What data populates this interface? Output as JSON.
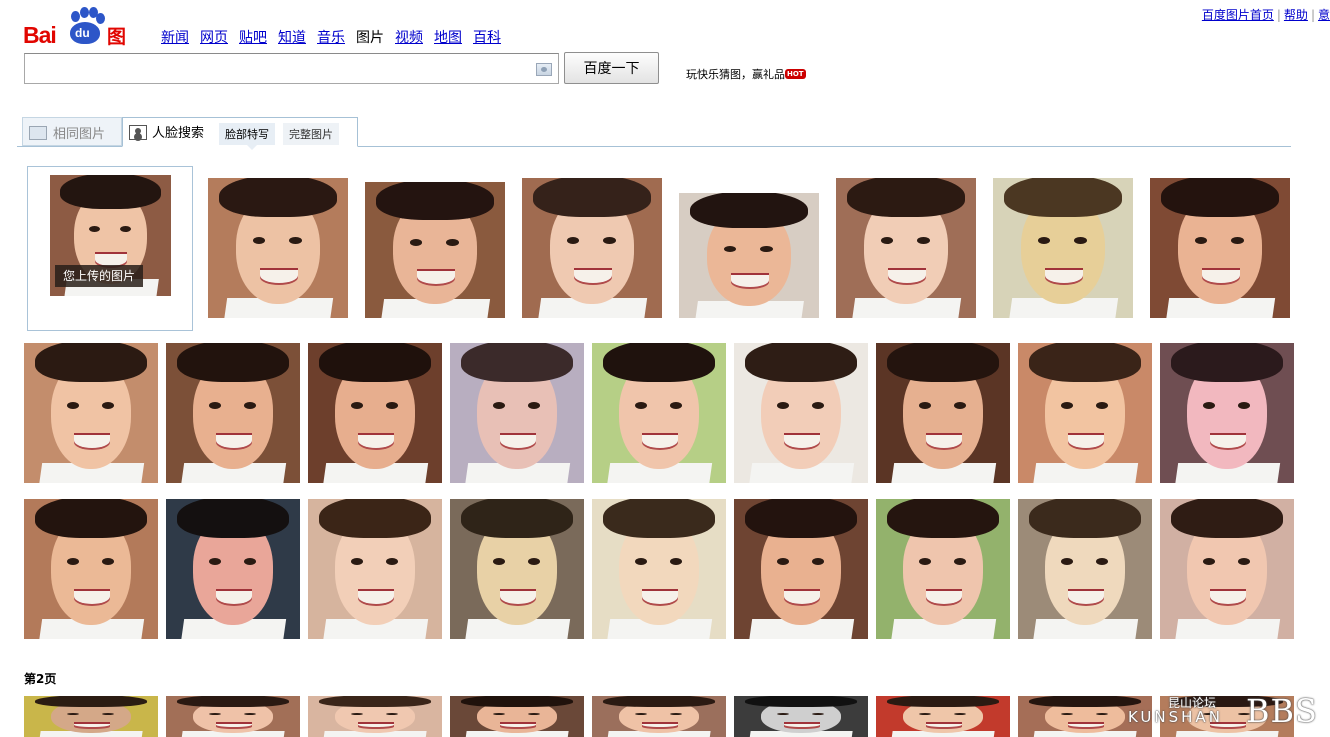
{
  "top_links": {
    "home": "百度图片首页",
    "help": "帮助",
    "more": "意"
  },
  "logo": {
    "bai": "Bai",
    "du": "du",
    "pic": "图片"
  },
  "nav": [
    {
      "label": "新闻",
      "current": false
    },
    {
      "label": "网页",
      "current": false
    },
    {
      "label": "贴吧",
      "current": false
    },
    {
      "label": "知道",
      "current": false
    },
    {
      "label": "音乐",
      "current": false
    },
    {
      "label": "图片",
      "current": true
    },
    {
      "label": "视频",
      "current": false
    },
    {
      "label": "地图",
      "current": false
    },
    {
      "label": "百科",
      "current": false
    }
  ],
  "search": {
    "value": "",
    "placeholder": "",
    "button_label": "百度一下"
  },
  "promo": {
    "text": "玩快乐猜图，赢礼品",
    "badge": "HOT"
  },
  "tabs": {
    "same": "相同图片",
    "face": "人脸搜索",
    "sub_facial": "脸部特写",
    "sub_full": "完整图片"
  },
  "upload": {
    "caption": "您上传的图片"
  },
  "page2_label": "第2页",
  "watermark": {
    "cn": "昆山论坛",
    "en": "KUNSHAN",
    "big": "BBS"
  },
  "colors": {
    "brand_red": "#e10601",
    "brand_blue": "#2d56c8",
    "link": "#0000cc",
    "tab_border": "#a6c1d6"
  },
  "results": [
    {
      "bg": "#b47c5c",
      "skin": "#edc2a4",
      "hair": "#2a1812"
    },
    {
      "bg": "#8a5a3e",
      "skin": "#e9b597",
      "hair": "#241410"
    },
    {
      "bg": "#a06b50",
      "skin": "#efc9b1",
      "hair": "#35221a"
    },
    {
      "bg": "#d7cdc3",
      "skin": "#ebb797",
      "hair": "#221410"
    },
    {
      "bg": "#9f6e57",
      "skin": "#f1cdb6",
      "hair": "#2c1a12"
    },
    {
      "bg": "#d7d3b8",
      "skin": "#e7cf98",
      "hair": "#4b3722"
    },
    {
      "bg": "#7f4a34",
      "skin": "#eab393",
      "hair": "#24130e"
    },
    {
      "bg": "#c38d6c",
      "skin": "#f0c3a4",
      "hair": "#2b1a12"
    },
    {
      "bg": "#7c5038",
      "skin": "#e8b08f",
      "hair": "#22130d"
    },
    {
      "bg": "#6d3f2c",
      "skin": "#e7ae8e",
      "hair": "#1f110c"
    },
    {
      "bg": "#b8aec0",
      "skin": "#e8c0b6",
      "hair": "#3b2a2a"
    },
    {
      "bg": "#b6cf86",
      "skin": "#f0c5ab",
      "hair": "#1f120d"
    },
    {
      "bg": "#ece8e2",
      "skin": "#f2cdb8",
      "hair": "#2e1d15"
    },
    {
      "bg": "#5b3525",
      "skin": "#e6b090",
      "hair": "#24140e"
    },
    {
      "bg": "#c98968",
      "skin": "#f2c4a1",
      "hair": "#3a2418"
    },
    {
      "bg": "#6f4e52",
      "skin": "#f2b8bf",
      "hair": "#2b1a1c"
    },
    {
      "bg": "#b37a5a",
      "skin": "#ebb996",
      "hair": "#23140e"
    },
    {
      "bg": "#2f3a48",
      "skin": "#e9a699",
      "hair": "#141010"
    },
    {
      "bg": "#d6b49e",
      "skin": "#f2cfb8",
      "hair": "#3b2517"
    },
    {
      "bg": "#7a6a5a",
      "skin": "#e8d1a6",
      "hair": "#2f2418"
    },
    {
      "bg": "#e6ddc5",
      "skin": "#f2d8bd",
      "hair": "#3a2a1c"
    },
    {
      "bg": "#6e4432",
      "skin": "#e9b190",
      "hair": "#23130e"
    },
    {
      "bg": "#93b26c",
      "skin": "#efc5ad",
      "hair": "#25150f"
    },
    {
      "bg": "#9c8b78",
      "skin": "#efd9bd",
      "hair": "#3b2a1c"
    },
    {
      "bg": "#d1b0a3",
      "skin": "#f1c7b0",
      "hair": "#2f1c14"
    },
    {
      "bg": "#c9b64a",
      "skin": "#d4a888",
      "hair": "#2b1c12"
    },
    {
      "bg": "#a26f57",
      "skin": "#efc2a8",
      "hair": "#2a1912"
    },
    {
      "bg": "#d9b5a0",
      "skin": "#f0c8b0",
      "hair": "#3a2519"
    },
    {
      "bg": "#6a4838",
      "skin": "#e9b597",
      "hair": "#20120c"
    },
    {
      "bg": "#9b6f5c",
      "skin": "#efc2a6",
      "hair": "#2b1a12"
    },
    {
      "bg": "#3c3c3c",
      "skin": "#cfcfcf",
      "hair": "#111111"
    },
    {
      "bg": "#c23a2c",
      "skin": "#efc6a9",
      "hair": "#2b1a12"
    },
    {
      "bg": "#a56e57",
      "skin": "#eebc9c",
      "hair": "#25150f"
    }
  ]
}
